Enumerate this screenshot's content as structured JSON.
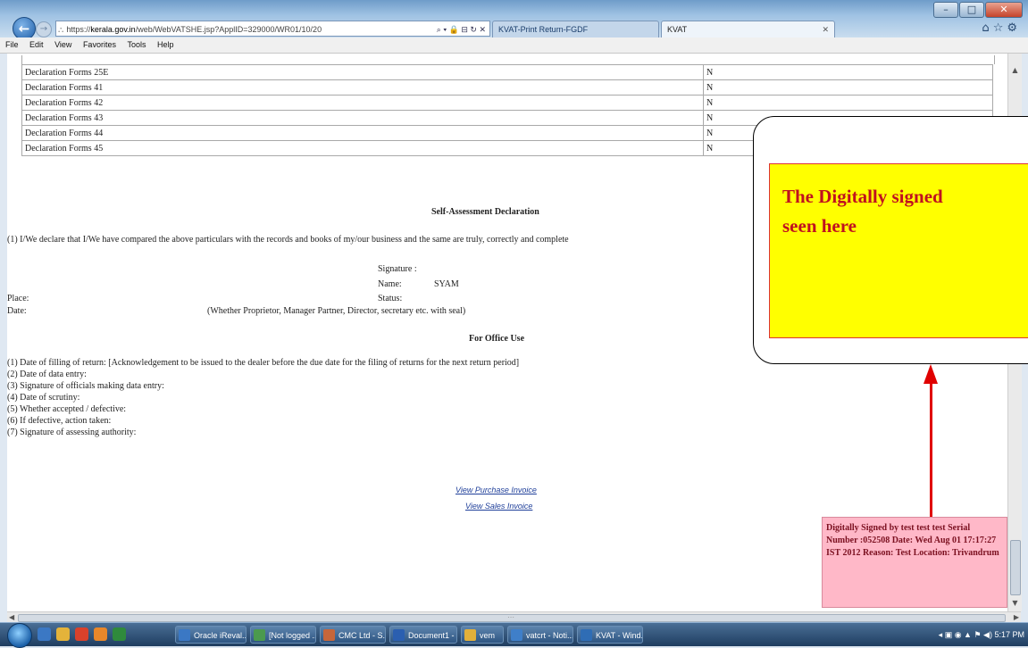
{
  "browser": {
    "url_scheme": "https://",
    "url_host": "kerala.gov.in",
    "url_rest": "/web/WebVATSHE.jsp?ApplID=329000/WR01/10/20",
    "tabs": [
      {
        "label": "KVAT-Print Return-FGDF",
        "active": true
      },
      {
        "label": "KVAT",
        "active": false
      }
    ],
    "menu": [
      "File",
      "Edit",
      "View",
      "Favorites",
      "Tools",
      "Help"
    ]
  },
  "declaration_forms": [
    {
      "label": "Declaration Forms 25E",
      "value": "N"
    },
    {
      "label": "Declaration Forms 41",
      "value": "N"
    },
    {
      "label": "Declaration Forms 42",
      "value": "N"
    },
    {
      "label": "Declaration Forms 43",
      "value": "N"
    },
    {
      "label": "Declaration Forms 44",
      "value": "N"
    },
    {
      "label": "Declaration Forms 45",
      "value": "N"
    }
  ],
  "self_assessment": {
    "title": "Self-Assessment Declaration",
    "statement": "(1) I/We declare that I/We have compared the above particulars with the records and books of my/our business and the same are truly, correctly and complete",
    "signature_label": "Signature :",
    "name_label": "Name:",
    "name_value": "SYAM",
    "status_label": "Status:",
    "place_label": "Place:",
    "date_label": "Date:",
    "status_hint": "(Whether Proprietor, Manager Partner, Director, secretary etc. with seal)"
  },
  "office_use": {
    "title": "For Office Use",
    "items": [
      "(1) Date of filling of return: [Acknowledgement to be issued to the dealer before the due date for the filing of returns for the next return period]",
      "(2) Date of data entry:",
      "(3) Signature of officials making data entry:",
      "(4) Date of scrutiny:",
      "(5) Whether accepted / defective:",
      "(6) If defective, action taken:",
      "(7) Signature of assessing authority:"
    ]
  },
  "links": {
    "purchase": "View Purchase Invoice",
    "sales": "View Sales Invoice"
  },
  "callout": {
    "line1": "The Digitally signed",
    "line2": "seen here"
  },
  "signature_stamp": {
    "text": "Digitally Signed by test test test Serial Number :052508 Date: Wed Aug 01 17:17:27 IST 2012 Reason: Test Location: Trivandrum"
  },
  "taskbar": {
    "tasks": [
      "Oracle iReval...",
      "[Not logged ...",
      "CMC Ltd - S...",
      "Document1 - ...",
      "vem",
      "vatcrt - Noti...",
      "KVAT - Wind..."
    ],
    "clock": "5:17 PM"
  },
  "colors": {
    "callout_bg": "#ffff00",
    "callout_text": "#c0111f",
    "arrow": "#e00000",
    "signature_bg": "#ffb8c8"
  }
}
